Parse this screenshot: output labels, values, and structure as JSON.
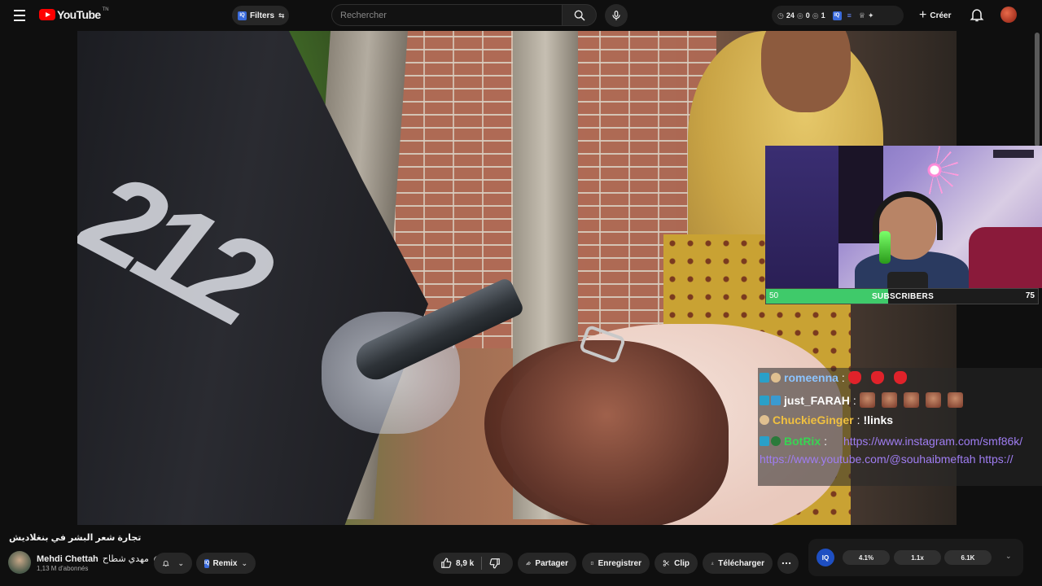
{
  "header": {
    "logo_text": "YouTube",
    "logo_tm": "TN",
    "filters_label": "Filters",
    "search_placeholder": "Rechercher",
    "stats": [
      "24",
      "0",
      "1"
    ],
    "create_label": "Créer"
  },
  "overlay": {
    "subs_start": "50",
    "subs_label": "SUBSCRIBERS",
    "subs_goal": "75",
    "subs_progress": 0.45,
    "chat": [
      {
        "user": "romeenna",
        "user_color": "#8cc4ff",
        "badges": [
          "prime",
          "face"
        ],
        "emotes": "red",
        "emote_count": 3,
        "text": ""
      },
      {
        "user": "just_FARAH",
        "user_color": "#ffffff",
        "badges": [
          "prime",
          "mod"
        ],
        "emotes": "face",
        "emote_count": 5,
        "text": ""
      },
      {
        "user": "ChuckieGinger",
        "user_color": "#f0c040",
        "badges": [
          "face"
        ],
        "emotes": "",
        "emote_count": 0,
        "text": "!links"
      },
      {
        "user": "BotRix",
        "user_color": "#39d353",
        "badges": [
          "prime",
          "check"
        ],
        "emotes": "",
        "emote_count": 0,
        "text": "https://www.instagram.com/smf86k/"
      },
      {
        "user": "",
        "user_color": "#ffffff",
        "badges": [],
        "emotes": "",
        "emote_count": 0,
        "text": "https://www.youtube.com/@souhaibmeftah   https://"
      }
    ]
  },
  "video": {
    "title": "تجارة شعر البشر في بنغلاديش",
    "channel_name": "Mehdi Chettah",
    "channel_arabic": "مهدي شطاح",
    "subscribers": "1,13 M d'abonnés"
  },
  "actions": {
    "remix": "Remix",
    "likes": "8,9 k",
    "share": "Partager",
    "save": "Enregistrer",
    "clip": "Clip",
    "download": "Télécharger"
  },
  "iq_panel": {
    "label": "IQ",
    "values": [
      "4.1%",
      "1.1x",
      "6.1K"
    ]
  },
  "icons": {
    "menu": "menu-icon",
    "search": "search-icon",
    "mic": "mic-icon",
    "bell": "bell-icon",
    "like": "thumb-up-icon",
    "dislike": "thumb-down-icon",
    "share": "share-icon",
    "save": "bookmark-icon",
    "clip": "scissors-icon",
    "download": "download-icon",
    "more": "more-horizontal-icon"
  },
  "colors": {
    "brand": "#ff0000",
    "background": "#0f0f0f",
    "progress": "#3fca6a",
    "link": "#9f7df2"
  }
}
